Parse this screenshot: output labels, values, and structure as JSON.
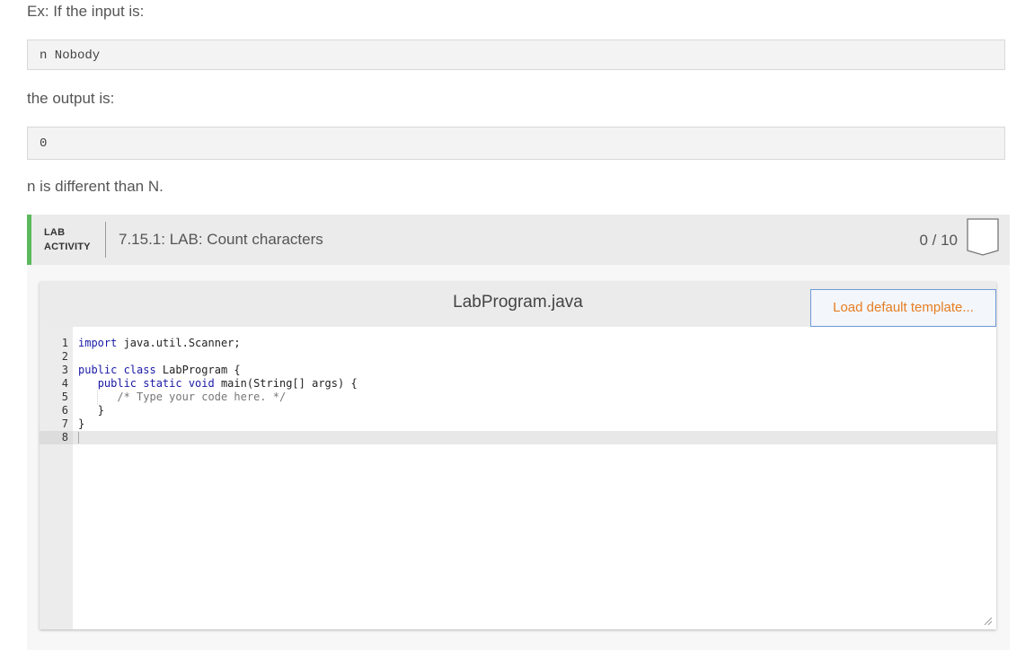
{
  "intro": {
    "example_label": "Ex: If the input is:",
    "example_input": "n Nobody",
    "output_label": "the output is:",
    "example_output": "0",
    "note": "n is different than N."
  },
  "lab": {
    "tag_line1": "LAB",
    "tag_line2": "ACTIVITY",
    "title": "7.15.1: LAB: Count characters",
    "score": "0 / 10",
    "accent_color": "#5cb85c"
  },
  "editor": {
    "file_name": "LabProgram.java",
    "load_button_label": "Load default template...",
    "line_numbers": [
      "1",
      "2",
      "3",
      "4",
      "5",
      "6",
      "7",
      "8"
    ],
    "lines": [
      {
        "kw": "import",
        "rest": " java.util.Scanner;"
      },
      {
        "kw": "",
        "rest": ""
      },
      {
        "kw": "public class",
        "rest": " LabProgram {"
      },
      {
        "indent": "   ",
        "kw": "public static void",
        "rest": " main(String[] args) {"
      },
      {
        "indent": "      ",
        "comment": "/* Type your code here. */"
      },
      {
        "indent": "   ",
        "rest": "}"
      },
      {
        "rest": "}"
      },
      {
        "rest": ""
      }
    ]
  }
}
